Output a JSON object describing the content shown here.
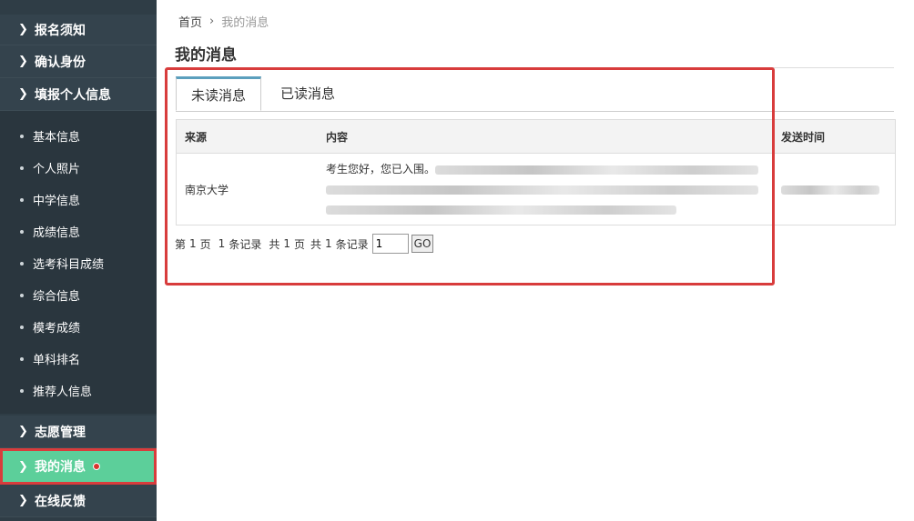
{
  "sidebar": {
    "top_items": [
      {
        "label": "报名须知"
      },
      {
        "label": "确认身份"
      },
      {
        "label": "填报个人信息"
      }
    ],
    "sub_items": [
      {
        "label": "基本信息"
      },
      {
        "label": "个人照片"
      },
      {
        "label": "中学信息"
      },
      {
        "label": "成绩信息"
      },
      {
        "label": "选考科目成绩"
      },
      {
        "label": "综合信息"
      },
      {
        "label": "模考成绩"
      },
      {
        "label": "单科排名"
      },
      {
        "label": "推荐人信息"
      }
    ],
    "bottom_items": [
      {
        "label": "志愿管理"
      },
      {
        "label": "我的消息",
        "active": true,
        "has_notification": true
      },
      {
        "label": "在线反馈"
      }
    ]
  },
  "breadcrumb": {
    "home": "首页",
    "current": "我的消息"
  },
  "page_title": "我的消息",
  "tabs": [
    {
      "label": "未读消息",
      "active": true
    },
    {
      "label": "已读消息",
      "active": false
    }
  ],
  "table": {
    "headers": {
      "source": "来源",
      "content": "内容",
      "time": "发送时间"
    },
    "rows": [
      {
        "source": "南京大学",
        "content_visible": "考生您好，您已入围。"
      }
    ]
  },
  "pager": {
    "page_prefix": "第",
    "page_current": "1",
    "page_suffix": "页",
    "records_count": "1",
    "records_label": "条记录",
    "total_prefix": "共",
    "total_pages": "1",
    "total_pages_suffix": "页",
    "total_records_prefix": "共",
    "total_records": "1",
    "total_records_suffix": "条记录",
    "input_value": "1",
    "go_label": "GO"
  },
  "colors": {
    "sidebar_bg": "#2f3d46",
    "active_bg": "#5ccf9a",
    "highlight_border": "#d83c3c",
    "tab_accent": "#5b9fbd"
  }
}
